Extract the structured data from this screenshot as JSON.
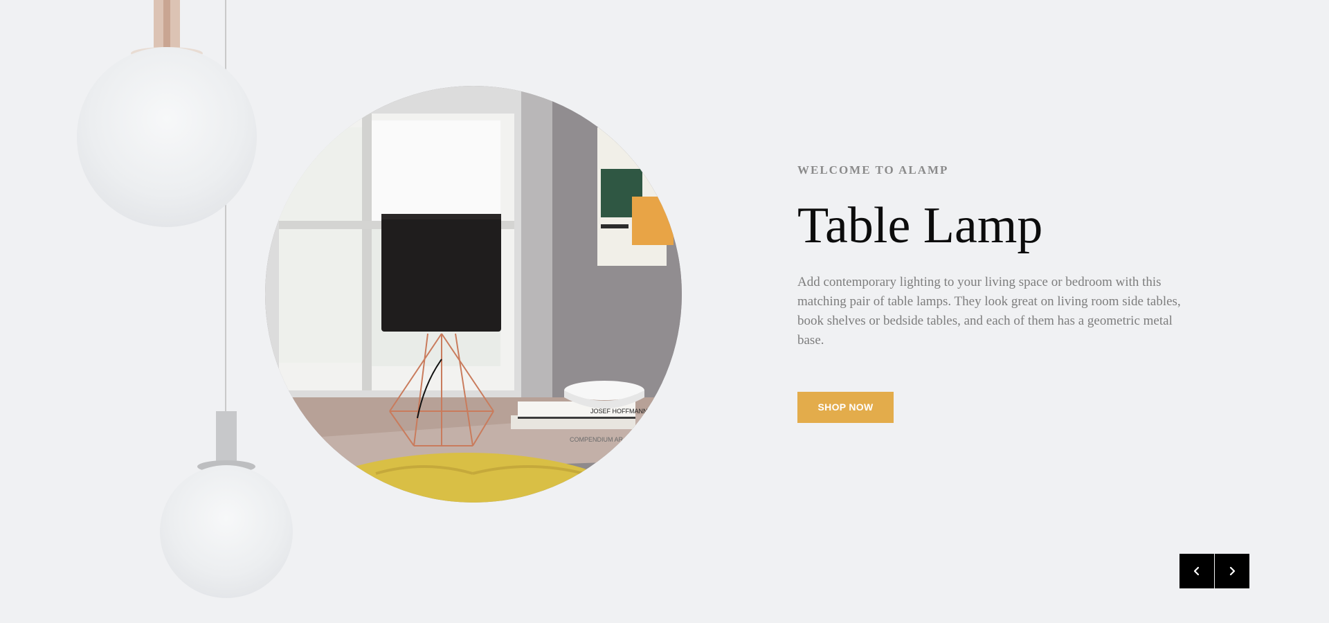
{
  "hero": {
    "eyebrow": "WELCOME TO ALAMP",
    "title": "Table Lamp",
    "description": "Add contemporary lighting to your living space or bedroom with this matching pair of table lamps. They look great on living room side tables, book shelves or bedside tables, and each of them has a geometric metal base.",
    "cta_label": "SHOP NOW",
    "image_subject": "table-lamp-photo",
    "book_spine_1": "JOSEF HOFFMANN",
    "book_spine_2": "COMPENDIUM AR"
  },
  "slider_nav": {
    "prev_icon": "chevron-left-icon",
    "next_icon": "chevron-right-icon"
  },
  "decor": {
    "pendant_icon": "pendant-lamp-decor"
  },
  "colors": {
    "background": "#f0f1f3",
    "accent": "#e3ac4b",
    "nav_bg": "#000000",
    "title": "#0c0c0c",
    "muted_text": "#8a8a8a"
  }
}
